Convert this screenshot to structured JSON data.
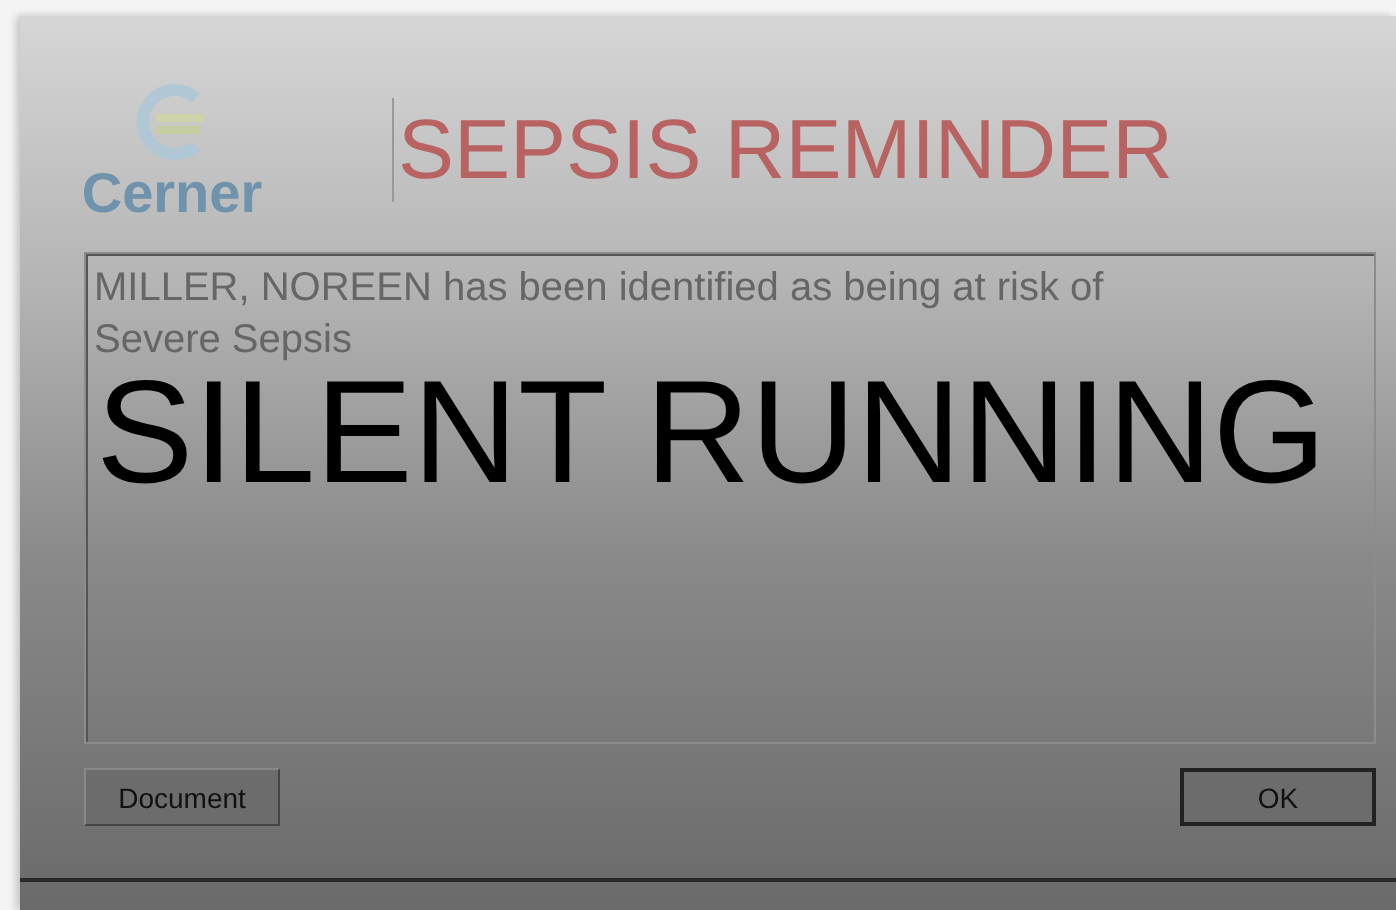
{
  "dialog": {
    "logo_text": "Cerner",
    "title": "SEPSIS REMINDER",
    "message": "MILLER, NOREEN has been identified as being at risk of Severe Sepsis",
    "buttons": [
      {
        "label": "Document",
        "kind": "normal"
      },
      {
        "label": "OK",
        "kind": "default"
      }
    ]
  },
  "overlay_caption": "SILENT RUNNING"
}
